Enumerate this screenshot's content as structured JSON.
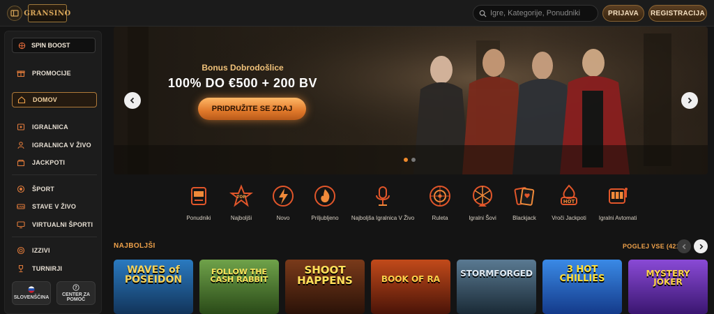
{
  "header": {
    "logo_text": "GRANSINO",
    "search_placeholder": "Igre, Kategorije, Ponudniki",
    "login_label": "PRIJAVA",
    "register_label": "REGISTRACIJA",
    "icons": [
      "menu-toggle-icon",
      "search-icon"
    ]
  },
  "sidebar": {
    "spin_boost": "SPIN BOOST",
    "items": [
      {
        "label": "PROMOCIJE",
        "icon": "gift-icon"
      },
      {
        "label": "DOMOV",
        "icon": "home-icon",
        "active": true
      },
      {
        "label": "IGRALNICA",
        "icon": "casino-icon"
      },
      {
        "label": "IGRALNICA V ŽIVO",
        "icon": "live-casino-icon"
      },
      {
        "label": "JACKPOTI",
        "icon": "jackpot-icon"
      },
      {
        "label": "ŠPORT",
        "icon": "ball-icon"
      },
      {
        "label": "STAVE V ŽIVO",
        "icon": "live-icon"
      },
      {
        "label": "VIRTUALNI ŠPORTI",
        "icon": "monitor-icon"
      },
      {
        "label": "IZZIVI",
        "icon": "target-icon"
      },
      {
        "label": "TURNIRJI",
        "icon": "trophy-icon"
      }
    ],
    "language_label": "SLOVENŠČINA",
    "help_line1": "CENTER ZA",
    "help_line2": "POMOČ"
  },
  "hero": {
    "subtitle": "Bonus Dobrodošlice",
    "title": "100% DO €500 + 200 BV",
    "cta_label": "PRIDRUŽITE SE ZDAJ"
  },
  "categories": [
    {
      "label": "Ponudniki",
      "icon": "slot-machine-icon"
    },
    {
      "label": "Najboljši",
      "icon": "star-icon"
    },
    {
      "label": "Novo",
      "icon": "lightning-icon"
    },
    {
      "label": "Priljubljeno",
      "icon": "flame-icon"
    },
    {
      "label": "Najboljša Igralnica V Živo",
      "icon": "microphone-icon"
    },
    {
      "label": "Ruleta",
      "icon": "roulette-icon"
    },
    {
      "label": "Igralni Šovi",
      "icon": "wheel-icon"
    },
    {
      "label": "Blackjack",
      "icon": "cards-icon"
    },
    {
      "label": "Vroči Jackpoti",
      "icon": "hot-icon"
    },
    {
      "label": "Igralni Avtomati",
      "icon": "slots-icon"
    }
  ],
  "section": {
    "title": "NAJBOLJŠI",
    "view_all": "POGLEJ VSE (421)"
  },
  "games": [
    {
      "title": "WAVES of POSEIDON",
      "bg": "#1f5f9a",
      "color": "#f6d35a"
    },
    {
      "title": "FOLLOW THE CASH RABBIT",
      "bg": "#3f6b2a",
      "color": "#f9e25a"
    },
    {
      "title": "SHOOT HAPPENS",
      "bg": "#5a2a12",
      "color": "#ffe05a"
    },
    {
      "title": "BOOK OF RA",
      "bg": "#8a2a12",
      "color": "#ffcf4a"
    },
    {
      "title": "STORMFORGED",
      "bg": "#2f4a5e",
      "color": "#dfe9f2"
    },
    {
      "title": "3 HOT CHILLIES",
      "bg": "#1e5fc7",
      "color": "#ffdf3a"
    },
    {
      "title": "MYSTERY JOKER",
      "bg": "#6a2fb0",
      "color": "#ffd34a"
    }
  ],
  "colors": {
    "accent": "#f0a24a",
    "background": "#141414"
  }
}
